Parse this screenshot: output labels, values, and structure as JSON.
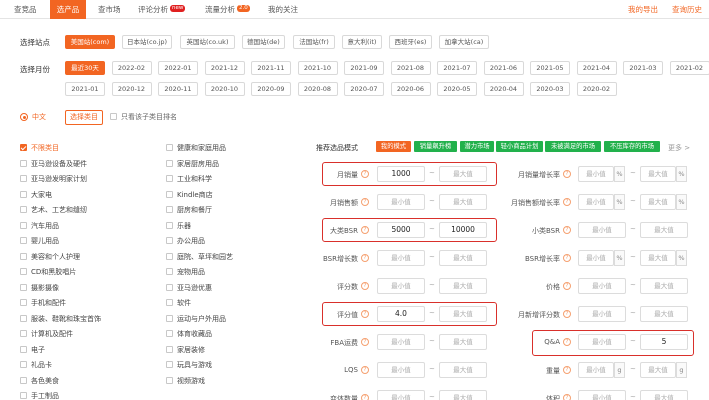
{
  "nav": {
    "tabs": [
      {
        "label": "查竞品"
      },
      {
        "label": "选产品"
      },
      {
        "label": "查市场"
      },
      {
        "label": "评论分析",
        "badge": "new"
      },
      {
        "label": "流量分析",
        "badge": "2.0"
      },
      {
        "label": "我的关注"
      }
    ],
    "right_links": [
      {
        "label": "我的导出"
      },
      {
        "label": "查询历史"
      }
    ]
  },
  "site": {
    "label": "选择站点",
    "options": [
      "美国站(com)",
      "日本站(co.jp)",
      "英国站(co.uk)",
      "德国站(de)",
      "法国站(fr)",
      "意大利(it)",
      "西班牙(es)",
      "加拿大站(ca)"
    ],
    "selected": "美国站(com)"
  },
  "month": {
    "label": "选择月份",
    "row1": [
      "最近30天",
      "2022-02",
      "2022-01",
      "2021-12",
      "2021-11",
      "2021-10",
      "2021-09",
      "2021-08",
      "2021-07",
      "2021-06",
      "2021-05",
      "2021-04",
      "2021-03",
      "2021-02"
    ],
    "row2": [
      "2021-01",
      "2020-12",
      "2020-11",
      "2020-10",
      "2020-09",
      "2020-08",
      "2020-07",
      "2020-06",
      "2020-05",
      "2020-04",
      "2020-03",
      "2020-02"
    ],
    "selected": "最近30天"
  },
  "lang": {
    "chinese": "中文",
    "choose_category": "选择类目",
    "only_subcategory": "只看该子类目排名"
  },
  "categories": {
    "col1": [
      "不限类目",
      "亚马逊设备及硬件",
      "亚马逊发明家计划",
      "大家电",
      "艺术、工艺和缝纫",
      "汽车用品",
      "婴儿用品",
      "美容和个人护理",
      "CD和黑胶唱片",
      "摄影摄像",
      "手机和配件",
      "服装、鞋靴和珠宝首饰",
      "计算机及配件",
      "电子",
      "礼品卡",
      "各色美食",
      "手工制品"
    ],
    "col2": [
      "健康和家庭用品",
      "家居厨房用品",
      "工业和科学",
      "Kindle商店",
      "厨房和餐厅",
      "乐器",
      "办公用品",
      "庭院、草坪和园艺",
      "宠物用品",
      "亚马逊优惠",
      "软件",
      "运动与户外用品",
      "体育收藏品",
      "家居装修",
      "玩具与游戏",
      "视频游戏"
    ]
  },
  "modes": {
    "label": "推荐选品模式",
    "items": [
      "我的模式",
      "销量飙升榜",
      "潜力市场",
      "轻小商品计划",
      "未被满足的市场",
      "不压库存的市场"
    ],
    "colors": [
      "#f26522",
      "#22b14c",
      "#22b14c",
      "#22b14c",
      "#22b14c",
      "#22b14c"
    ],
    "more": "更多 >"
  },
  "filters": {
    "min": "最小值",
    "max": "最大值",
    "left": [
      {
        "label": "月销量",
        "min": "1000",
        "max": "最大值"
      },
      {
        "label": "月销售额",
        "min": "最小值",
        "max": "最大值"
      },
      {
        "label": "大类BSR",
        "min": "5000",
        "max": "10000"
      },
      {
        "label": "BSR增长数",
        "min": "最小值",
        "max": "最大值"
      },
      {
        "label": "评分数",
        "min": "最小值",
        "max": "最大值"
      },
      {
        "label": "评分值",
        "min": "4.0",
        "max": "最大值"
      },
      {
        "label": "FBA运费",
        "min": "最小值",
        "max": "最大值"
      },
      {
        "label": "LQS",
        "min": "最小值",
        "max": "最大值"
      },
      {
        "label": "变体数量",
        "min": "最小值",
        "max": "最大值"
      }
    ],
    "right": [
      {
        "label": "月销量增长率",
        "min": "最小值",
        "max": "最大值",
        "unit": "%"
      },
      {
        "label": "月销售额增长率",
        "min": "最小值",
        "max": "最大值",
        "unit": "%"
      },
      {
        "label": "小类BSR",
        "min": "最小值",
        "max": "最大值",
        "unit": ""
      },
      {
        "label": "BSR增长率",
        "min": "最小值",
        "max": "最大值",
        "unit": "%"
      },
      {
        "label": "价格",
        "min": "最小值",
        "max": "最大值",
        "unit": ""
      },
      {
        "label": "月新增评分数",
        "min": "最小值",
        "max": "最大值",
        "unit": ""
      },
      {
        "label": "Q&A",
        "min": "最小值",
        "max": "5",
        "unit": ""
      },
      {
        "label": "重量",
        "min": "最小值",
        "max": "最大值",
        "unit": "g"
      },
      {
        "label": "体积",
        "min": "最小值",
        "max": "最大值",
        "unit": ""
      }
    ]
  },
  "colors": {
    "accent": "#f26522",
    "highlight": "#d9302b",
    "green": "#22b14c"
  }
}
